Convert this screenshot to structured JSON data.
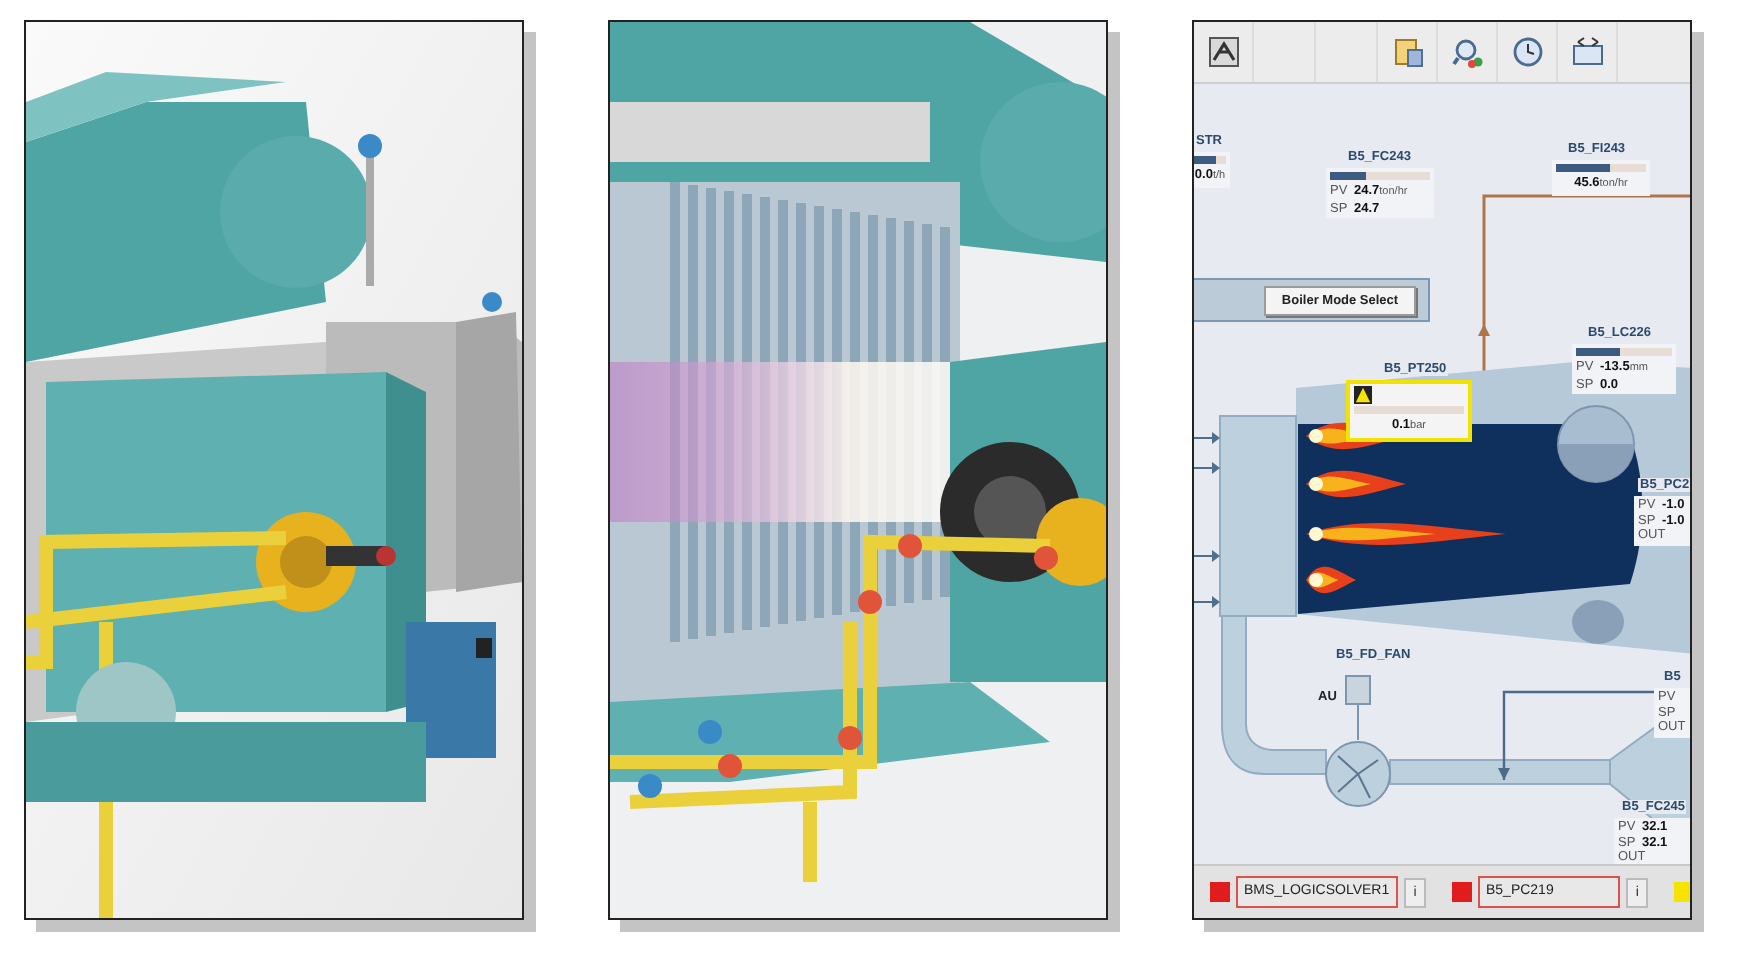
{
  "hmi": {
    "tags": [
      {
        "tag": "STR",
        "alarm": false,
        "level": 0.7,
        "rows": [
          {
            "value": "0.0",
            "unit": "t/h"
          }
        ]
      },
      {
        "tag": "B5_FC243",
        "alarm": false,
        "level": 0.35,
        "rows": [
          {
            "label": "PV",
            "value": "24.7",
            "unit": "ton/hr"
          },
          {
            "label": "SP",
            "value": "24.7"
          }
        ]
      },
      {
        "tag": "B5_FI243",
        "alarm": false,
        "level": 0.6,
        "rows": [
          {
            "value": "45.6",
            "unit": "ton/hr"
          }
        ]
      },
      {
        "tag": "B5_LC226",
        "alarm": false,
        "level": 0.45,
        "rows": [
          {
            "label": "PV",
            "value": "-13.5",
            "unit": "mm"
          },
          {
            "label": "SP",
            "value": "0.0"
          }
        ]
      },
      {
        "tag": "B5_PT250",
        "alarm": true,
        "rows": [
          {
            "value": "0.1",
            "unit": "bar"
          }
        ]
      },
      {
        "tag": "B5_PC2",
        "alarm": false,
        "rows": [
          {
            "label": "PV",
            "value": "-1.0"
          },
          {
            "label": "SP",
            "value": "-1.0"
          },
          {
            "label": "OUT"
          }
        ]
      },
      {
        "tag": "B5",
        "alarm": false,
        "rows": [
          {
            "label": "PV"
          },
          {
            "label": "SP"
          },
          {
            "label": "OUT"
          }
        ]
      },
      {
        "tag": "B5_FC245",
        "alarm": false,
        "rows": [
          {
            "label": "PV",
            "value": "32.1"
          },
          {
            "label": "SP",
            "value": "32.1"
          },
          {
            "label": "OUT"
          }
        ]
      }
    ],
    "mode_button": "Boiler Mode Select",
    "fan": {
      "tag": "B5_FD_FAN",
      "mode": "AU"
    },
    "status_bar": [
      {
        "label": "BMS_LOGICSOLVER1",
        "info": "i"
      },
      {
        "label": "B5_PC219",
        "info": "i"
      }
    ]
  }
}
